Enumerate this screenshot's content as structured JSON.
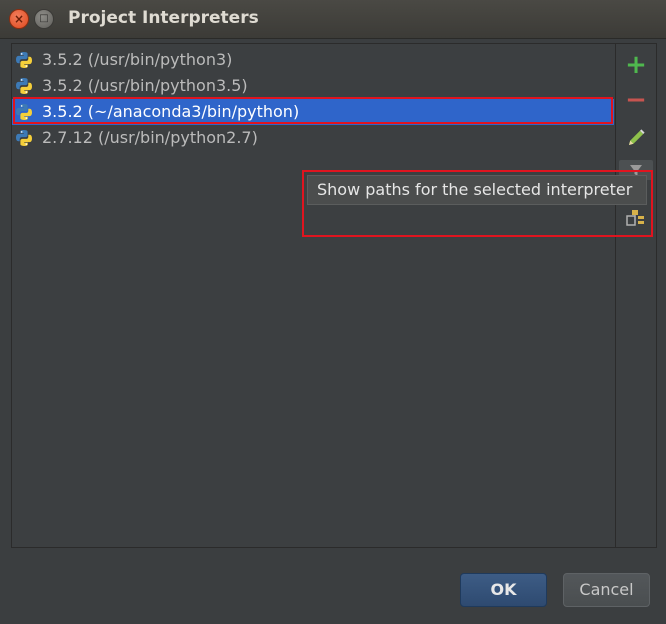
{
  "window": {
    "title": "Project Interpreters",
    "close_glyph": "×",
    "max_glyph": "□"
  },
  "interpreters": [
    {
      "label": "3.5.2 (/usr/bin/python3)",
      "selected": false
    },
    {
      "label": "3.5.2 (/usr/bin/python3.5)",
      "selected": false
    },
    {
      "label": "3.5.2 (~/anaconda3/bin/python)",
      "selected": true
    },
    {
      "label": "2.7.12 (/usr/bin/python2.7)",
      "selected": false
    }
  ],
  "toolbar": {
    "add_glyph": "+",
    "remove_glyph": "−",
    "icons": [
      "add-icon",
      "remove-icon",
      "pencil-icon",
      "filter-icon",
      "show-paths-icon"
    ]
  },
  "tooltip": {
    "text": "Show paths for the selected interpreter"
  },
  "buttons": {
    "ok": "OK",
    "cancel": "Cancel"
  },
  "colors": {
    "selection": "#2f65ca",
    "highlight_outline": "#e0141f",
    "add": "#4fb84e",
    "remove": "#c75450"
  }
}
